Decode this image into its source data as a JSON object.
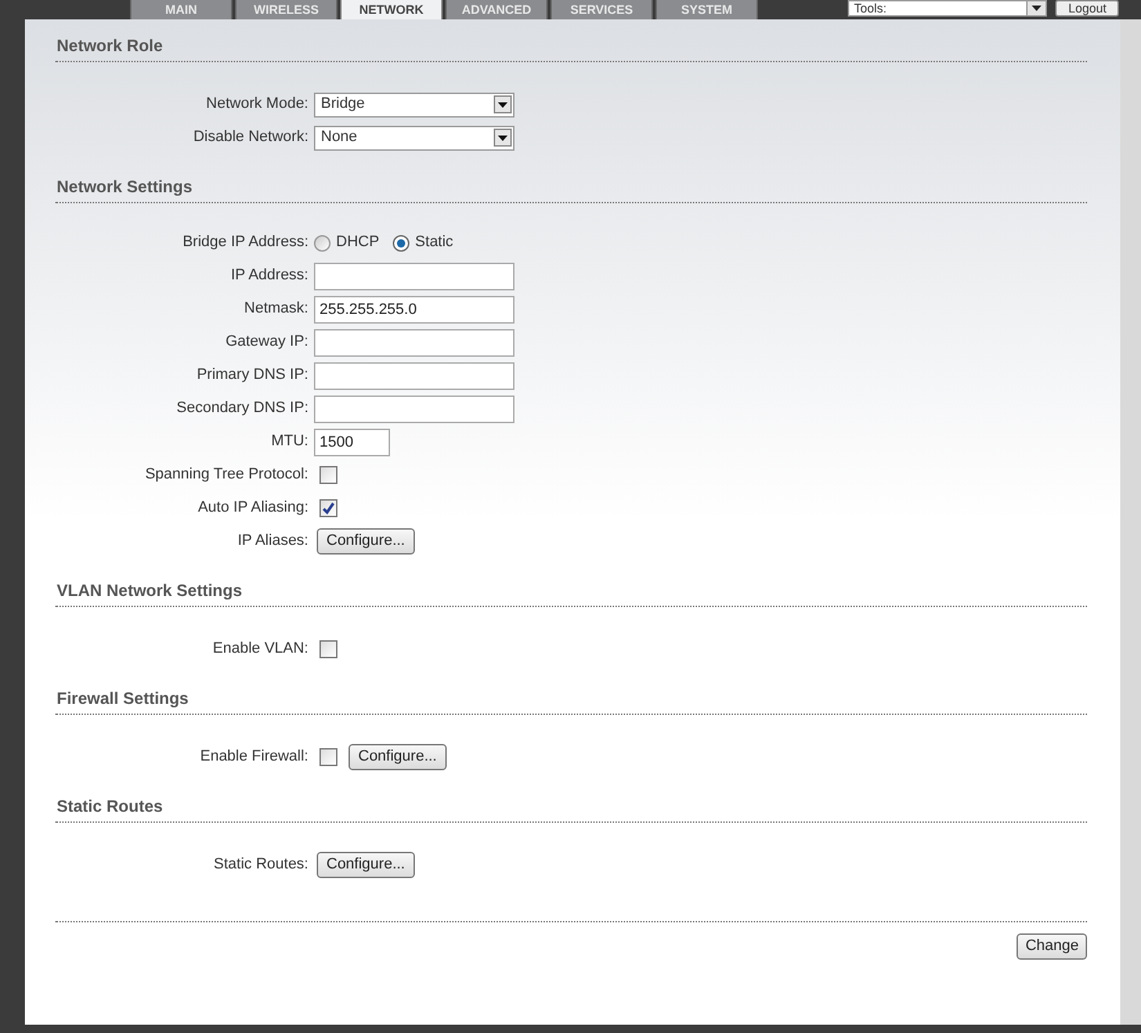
{
  "tabs": [
    {
      "label": "MAIN",
      "selected": false
    },
    {
      "label": "WIRELESS",
      "selected": false
    },
    {
      "label": "NETWORK",
      "selected": true
    },
    {
      "label": "ADVANCED",
      "selected": false
    },
    {
      "label": "SERVICES",
      "selected": false
    },
    {
      "label": "SYSTEM",
      "selected": false
    }
  ],
  "tools_select": {
    "value": "Tools:"
  },
  "logout_button": "Logout",
  "sections": [
    {
      "title": "Network Role",
      "rows": [
        {
          "kind": "select",
          "label": "Network Mode:",
          "value": "Bridge"
        },
        {
          "kind": "select",
          "label": "Disable Network:",
          "value": "None"
        }
      ]
    },
    {
      "title": "Network Settings",
      "rows": [
        {
          "kind": "radio",
          "label": "Bridge IP Address:",
          "options": [
            {
              "label": "DHCP",
              "selected": false
            },
            {
              "label": "Static",
              "selected": true
            }
          ]
        },
        {
          "kind": "text",
          "label": "IP Address:"
        },
        {
          "kind": "text",
          "label": "Netmask:",
          "value": "255.255.255.0"
        },
        {
          "kind": "text",
          "label": "Gateway IP:"
        },
        {
          "kind": "text",
          "label": "Primary DNS IP:"
        },
        {
          "kind": "text",
          "label": "Secondary DNS IP:"
        },
        {
          "kind": "short_text",
          "label": "MTU:",
          "value": "1500"
        },
        {
          "kind": "checkbox",
          "label": "Spanning Tree Protocol:",
          "checked": false
        },
        {
          "kind": "checkbox",
          "label": "Auto IP Aliasing:",
          "checked": true
        },
        {
          "kind": "button",
          "label": "IP Aliases:",
          "button": "Configure..."
        }
      ]
    },
    {
      "title": "VLAN Network Settings",
      "rows": [
        {
          "kind": "checkbox",
          "label": "Enable VLAN:",
          "checked": false
        }
      ]
    },
    {
      "title": "Firewall Settings",
      "rows": [
        {
          "kind": "checkbox_button",
          "label": "Enable Firewall:",
          "checked": false,
          "button": "Configure..."
        }
      ]
    },
    {
      "title": "Static Routes",
      "rows": [
        {
          "kind": "button",
          "label": "Static Routes:",
          "button": "Configure..."
        }
      ]
    }
  ],
  "change_button": "Change"
}
